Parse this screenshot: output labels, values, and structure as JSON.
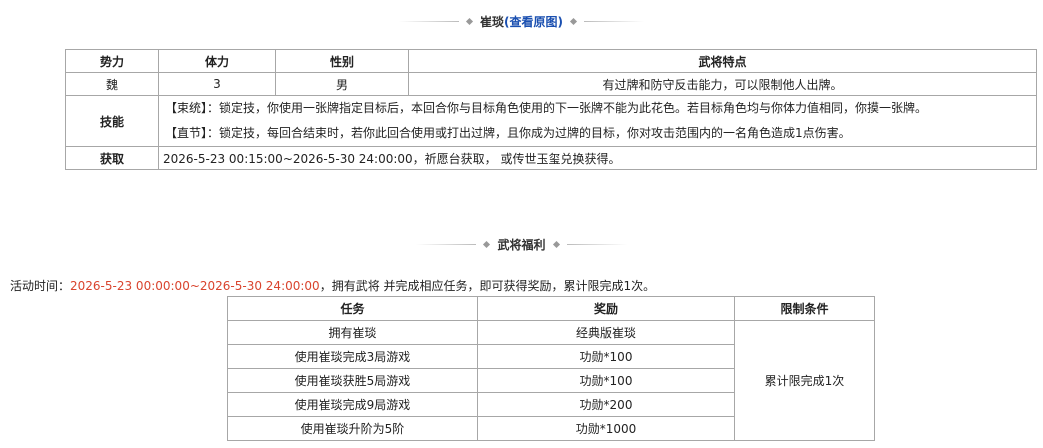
{
  "hero_section": {
    "title": "崔琰",
    "link": "(查看原图)"
  },
  "hero_table": {
    "headers": [
      "势力",
      "体力",
      "性别",
      "武将特点"
    ],
    "row": [
      "魏",
      "3",
      "男",
      "有过牌和防守反击能力，可以限制他人出牌。"
    ],
    "skills_label": "技能",
    "skills": [
      {
        "name": "【束统】：",
        "desc": "锁定技，你使用一张牌指定目标后，本回合你与目标角色使用的下一张牌不能为此花色。若目标角色均与你体力值相同，你摸一张牌。"
      },
      {
        "name": "【直节】：",
        "desc": "锁定技，每回合结束时，若你此回合使用或打出过牌，且你成为过牌的目标，你对攻击范围内的一名角色造成1点伤害。"
      }
    ],
    "obtain_label": "获取",
    "obtain_text": "2026-5-23 00:15:00~2026-5-30 24:00:00，祈愿台获取， 或传世玉玺兑换获得。"
  },
  "welfare_section": {
    "title": "武将福利"
  },
  "activity": {
    "prefix": "活动时间：",
    "time": "2026-5-23 00:00:00~2026-5-30 24:00:00",
    "suffix": "，拥有武将 并完成相应任务，即可获得奖励，累计限完成1次。"
  },
  "task_table": {
    "headers": [
      "任务",
      "奖励",
      "限制条件"
    ],
    "rows": [
      [
        "拥有崔琰",
        "经典版崔琰"
      ],
      [
        "使用崔琰完成3局游戏",
        "功勋*100"
      ],
      [
        "使用崔琰获胜5局游戏",
        "功勋*100"
      ],
      [
        "使用崔琰完成9局游戏",
        "功勋*200"
      ],
      [
        "使用崔琰升阶为5阶",
        "功勋*1000"
      ]
    ],
    "limit": "累计限完成1次"
  }
}
